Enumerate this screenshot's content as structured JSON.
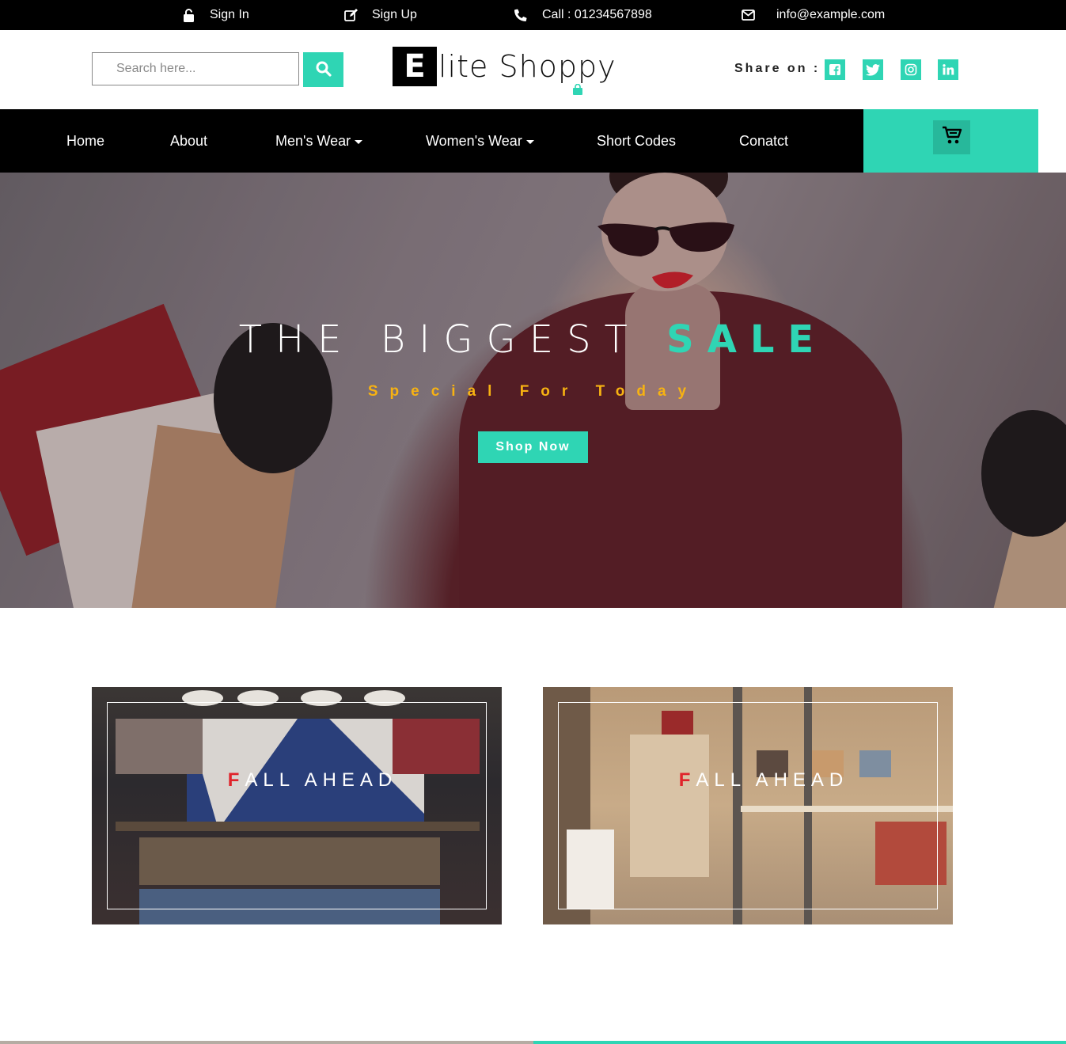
{
  "topbar": {
    "sign_in": "Sign In",
    "sign_up": "Sign Up",
    "call": "Call : 01234567898",
    "email": "info@example.com"
  },
  "header": {
    "search_placeholder": "Search here...",
    "logo_letter": "E",
    "logo_rest": "lite Shoppy",
    "share_label": "Share on :",
    "social_icons": [
      "facebook-icon",
      "twitter-icon",
      "instagram-icon",
      "linkedin-icon"
    ]
  },
  "nav": {
    "items": [
      {
        "label": "Home",
        "dropdown": false
      },
      {
        "label": "About",
        "dropdown": false
      },
      {
        "label": "Men's Wear",
        "dropdown": true
      },
      {
        "label": "Women's Wear",
        "dropdown": true
      },
      {
        "label": "Short Codes",
        "dropdown": false
      },
      {
        "label": "Conatct",
        "dropdown": false
      }
    ],
    "cart_icon": "cart-icon"
  },
  "hero": {
    "title_main": "THE BIGGEST ",
    "title_accent": "SALE",
    "subtitle": "Special For Today",
    "button": "Shop Now"
  },
  "promos": [
    {
      "first_letter": "F",
      "rest": "ALL AHEAD"
    },
    {
      "first_letter": "F",
      "rest": "ALL AHEAD"
    }
  ],
  "colors": {
    "accent": "#2fd5b4",
    "subtitle": "#f7b212",
    "promo_letter": "#e0242b",
    "nav_bg": "#000000"
  }
}
